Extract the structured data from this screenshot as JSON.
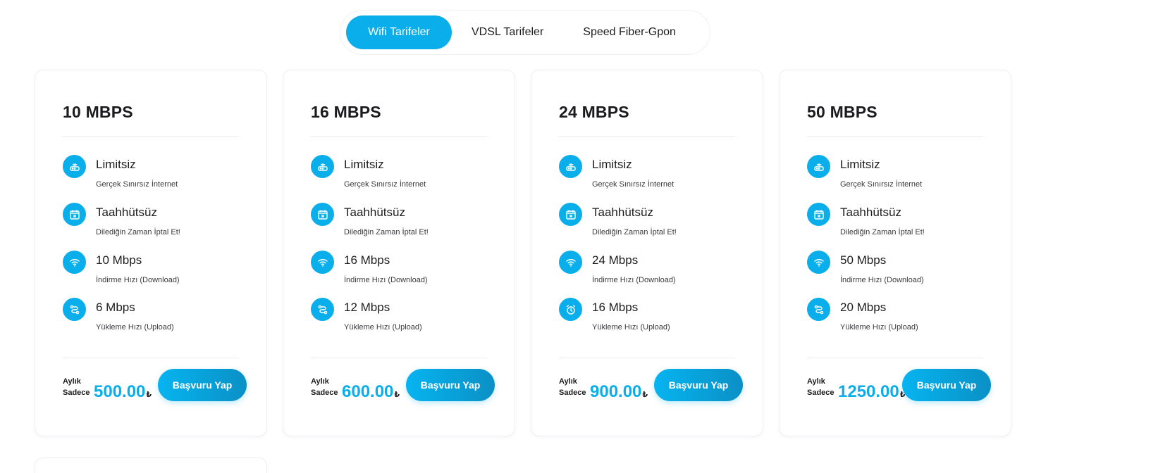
{
  "tabs": [
    {
      "label": "Wifi Tarifeler",
      "active": true
    },
    {
      "label": "VDSL Tarifeler",
      "active": false
    },
    {
      "label": "Speed Fiber-Gpon",
      "active": false
    }
  ],
  "colors": {
    "accent": "#09aeea",
    "text": "#1d1d1f"
  },
  "plans": [
    {
      "title": "10 MBPS",
      "features": [
        {
          "icon": "router-icon",
          "title": "Limitsiz",
          "subtitle": "Gerçek Sınırsız İnternet"
        },
        {
          "icon": "calendar-cancel-icon",
          "title": "Taahhütsüz",
          "subtitle": "Dilediğin Zaman İptal Et!"
        },
        {
          "icon": "wifi-icon",
          "title": "10 Mbps",
          "subtitle": "İndirme Hızı (Download)"
        },
        {
          "icon": "upload-route-icon",
          "title": "6 Mbps",
          "subtitle": "Yükleme Hızı (Upload)"
        }
      ],
      "price_label_1": "Aylık",
      "price_label_2": "Sadece",
      "price": "500.00",
      "currency": "₺",
      "button": "Başvuru Yap"
    },
    {
      "title": "16 MBPS",
      "features": [
        {
          "icon": "router-icon",
          "title": "Limitsiz",
          "subtitle": "Gerçek Sınırsız İnternet"
        },
        {
          "icon": "calendar-cancel-icon",
          "title": "Taahhütsüz",
          "subtitle": "Dilediğin Zaman İptal Et!"
        },
        {
          "icon": "wifi-icon",
          "title": "16 Mbps",
          "subtitle": "İndirme Hızı (Download)"
        },
        {
          "icon": "upload-route-icon",
          "title": "12 Mbps",
          "subtitle": "Yükleme Hızı (Upload)"
        }
      ],
      "price_label_1": "Aylık",
      "price_label_2": "Sadece",
      "price": "600.00",
      "currency": "₺",
      "button": "Başvuru Yap"
    },
    {
      "title": "24 MBPS",
      "features": [
        {
          "icon": "router-icon",
          "title": "Limitsiz",
          "subtitle": "Gerçek Sınırsız İnternet"
        },
        {
          "icon": "calendar-cancel-icon",
          "title": "Taahhütsüz",
          "subtitle": "Dilediğin Zaman İptal Et!"
        },
        {
          "icon": "wifi-icon",
          "title": "24 Mbps",
          "subtitle": "İndirme Hızı (Download)"
        },
        {
          "icon": "alarm-clock-icon",
          "title": "16 Mbps",
          "subtitle": "Yükleme Hızı (Upload)"
        }
      ],
      "price_label_1": "Aylık",
      "price_label_2": "Sadece",
      "price": "900.00",
      "currency": "₺",
      "button": "Başvuru Yap"
    },
    {
      "title": "50 MBPS",
      "features": [
        {
          "icon": "router-icon",
          "title": "Limitsiz",
          "subtitle": "Gerçek Sınırsız İnternet"
        },
        {
          "icon": "calendar-cancel-icon",
          "title": "Taahhütsüz",
          "subtitle": "Dilediğin Zaman İptal Et!"
        },
        {
          "icon": "wifi-icon",
          "title": "50 Mbps",
          "subtitle": "İndirme Hızı (Download)"
        },
        {
          "icon": "upload-route-icon",
          "title": "20 Mbps",
          "subtitle": "Yükleme Hızı (Upload)"
        }
      ],
      "price_label_1": "Aylık",
      "price_label_2": "Sadece",
      "price": "1250.00",
      "currency": "₺",
      "button": "Başvuru Yap"
    }
  ]
}
